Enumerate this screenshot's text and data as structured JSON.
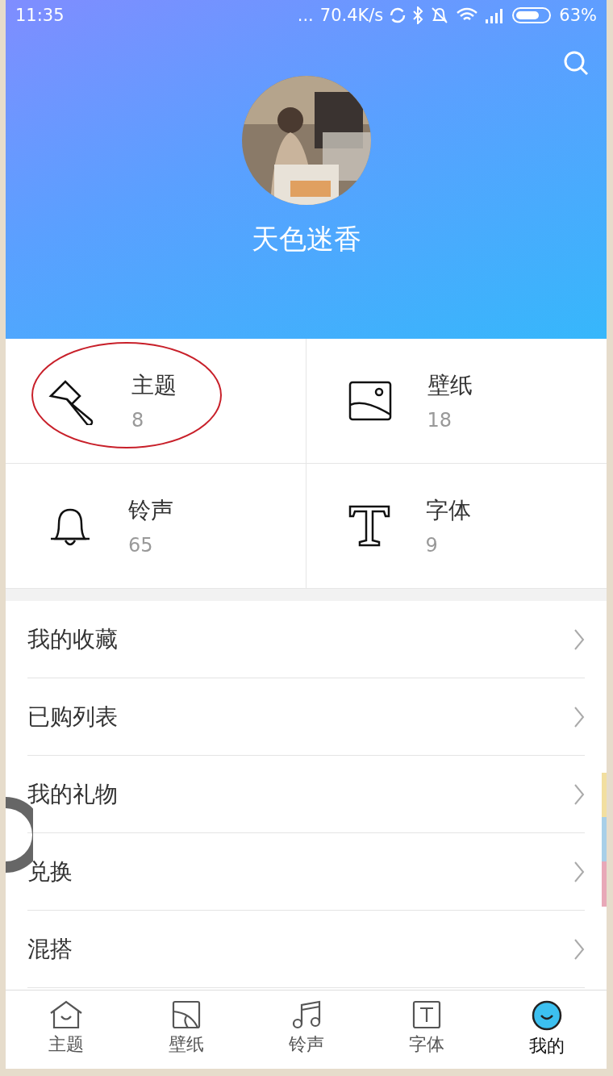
{
  "status_bar": {
    "time": "11:35",
    "dots": "...",
    "speed": "70.4K/s",
    "battery": "63%"
  },
  "profile": {
    "username": "天色迷香"
  },
  "categories": [
    {
      "kind": "theme",
      "label": "主题",
      "count": "8",
      "highlighted": true
    },
    {
      "kind": "wallpaper",
      "label": "壁纸",
      "count": "18",
      "highlighted": false
    },
    {
      "kind": "ringtone",
      "label": "铃声",
      "count": "65",
      "highlighted": false
    },
    {
      "kind": "font",
      "label": "字体",
      "count": "9",
      "highlighted": false
    }
  ],
  "menu": [
    {
      "label": "我的收藏"
    },
    {
      "label": "已购列表"
    },
    {
      "label": "我的礼物"
    },
    {
      "label": "兑换"
    },
    {
      "label": "混搭"
    }
  ],
  "bottom_nav": [
    {
      "kind": "theme",
      "label": "主题",
      "selected": false
    },
    {
      "kind": "wallpaper",
      "label": "壁纸",
      "selected": false
    },
    {
      "kind": "ringtone",
      "label": "铃声",
      "selected": false
    },
    {
      "kind": "font",
      "label": "字体",
      "selected": false
    },
    {
      "kind": "mine",
      "label": "我的",
      "selected": true
    }
  ]
}
